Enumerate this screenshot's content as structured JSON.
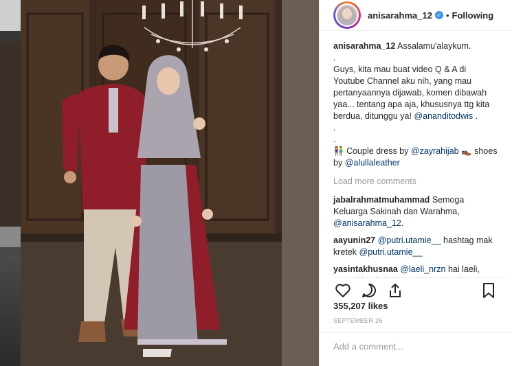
{
  "post": {
    "username": "anisarahma_12",
    "follow_status": "Following",
    "separator": "•",
    "caption": {
      "username": "anisarahma_12",
      "lines": [
        "Assalamu'alaykum.",
        ".",
        "Guys, kita mau buat video Q & A di",
        "Youtube Channel aku nih, yang mau",
        "pertanyaannya dijawab, komen dibawah",
        "yaa... tentang apa aja, khususnya ttg kita",
        "berdua, ditunggu ya!"
      ],
      "mention_1": "@ananditodwis",
      "after_mention": ".",
      "dots": [
        ".",
        "."
      ],
      "dress_emoji": "👫",
      "dress_text": "Couple dress by",
      "dress_mention": "@zayrahijab",
      "shoe_emoji": "👞",
      "shoe_text": "shoes",
      "by_text": "by",
      "shoe_mention": "@alullaleather"
    },
    "load_more": "Load more comments",
    "comments": [
      {
        "username": "jabalrahmatmuhammad",
        "text": "Semoga Keluarga Sakinah dan Warahma,",
        "mention": "@anisarahma_12",
        "tail": "."
      },
      {
        "username": "aayunin27",
        "mention": "@putri.utamie__",
        "text": "hashtag mak kretek",
        "mention2": "@putri.utamie__"
      },
      {
        "username": "yasintakhusnaa",
        "mention": "@laeli_nrzn",
        "text": "hai laeli, mung kin aja kok. Perbanyak usaha diimbangi do'a juga tentunya :)"
      }
    ],
    "likes": "355,207 likes",
    "date": "SEPTEMBER 26",
    "add_comment_placeholder": "Add a comment...",
    "icons": {
      "like": "heart-icon",
      "comment": "comment-icon",
      "share": "share-icon",
      "save": "bookmark-icon",
      "verified": "verified-badge-icon"
    },
    "colors": {
      "link": "#003569",
      "verified": "#3897f0",
      "muted": "#999999"
    }
  }
}
